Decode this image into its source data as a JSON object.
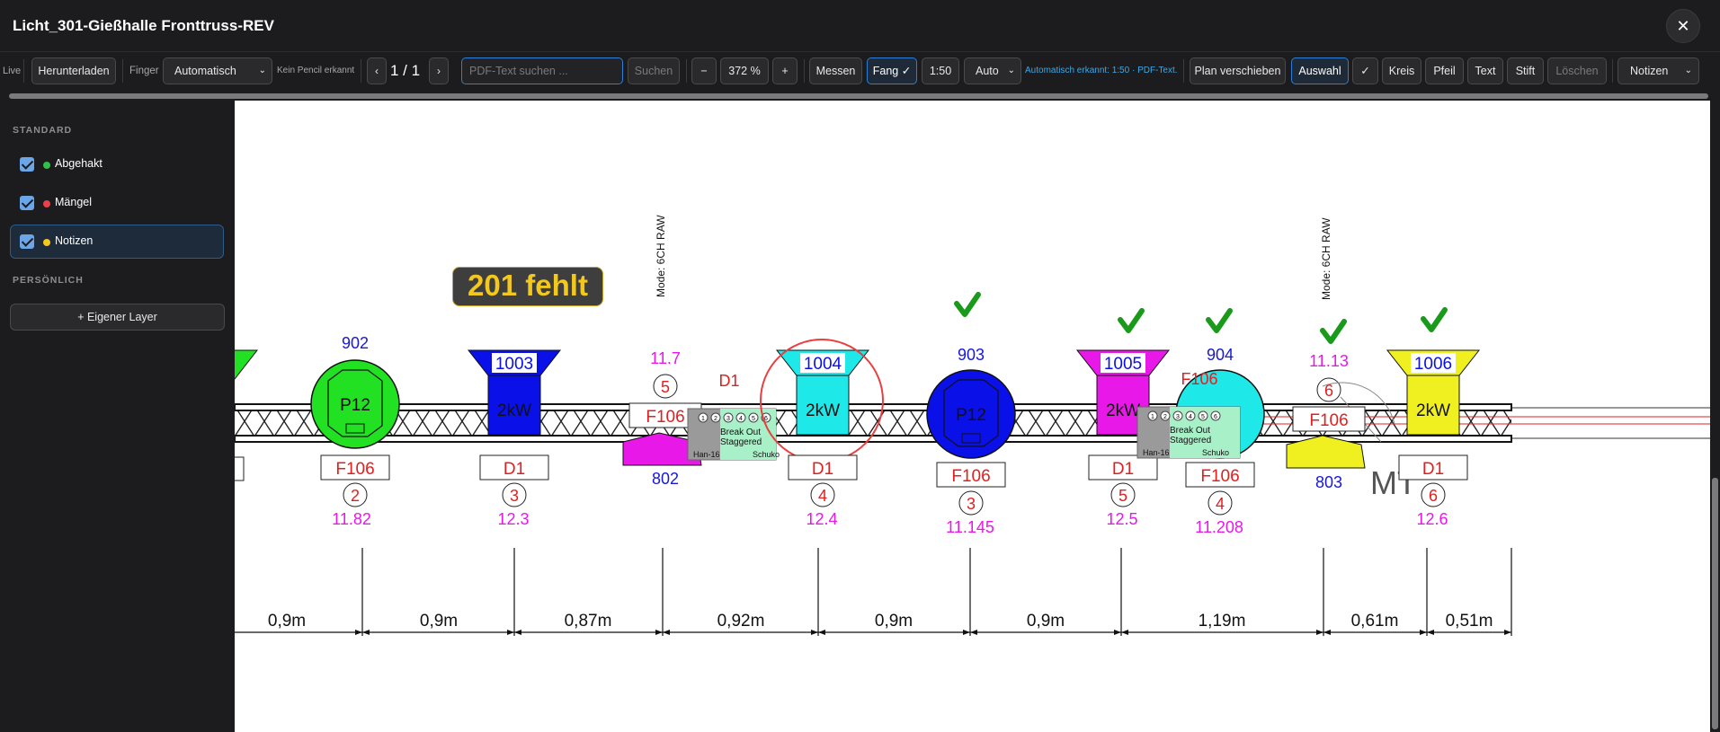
{
  "window": {
    "title": "Licht_301-Gießhalle Fronttruss-REV",
    "close_symbol": "✕"
  },
  "toolbar": {
    "live_label": "Live",
    "download_label": "Herunterladen",
    "finger_label": "Finger",
    "finger_select": "Automatisch",
    "pencil_status": "Kein Pencil erkannt",
    "page_prev": "‹",
    "page_indicator": "1 / 1",
    "page_next": "›",
    "search_placeholder": "PDF-Text suchen ...",
    "search_button": "Suchen",
    "zoom_out": "−",
    "zoom_level": "372 %",
    "zoom_in": "+",
    "measure_label": "Messen",
    "snap_label": "Fang ✓",
    "scale_label": "1:50",
    "scale_mode": "Auto",
    "scale_detected": "Automatisch erkannt: 1:50 · PDF-Text.",
    "move_plan_label": "Plan verschieben",
    "select_label": "Auswahl",
    "check_label": "✓",
    "circle_label": "Kreis",
    "arrow_label": "Pfeil",
    "text_label": "Text",
    "pen_label": "Stift",
    "delete_label": "Löschen",
    "layer_select": "Notizen"
  },
  "sidebar": {
    "standard_heading": "STANDARD",
    "layers": [
      {
        "label": "Abgehakt",
        "color": "#30c04a"
      },
      {
        "label": "Mängel",
        "color": "#e8414a"
      },
      {
        "label": "Notizen",
        "color": "#f3c81e"
      }
    ],
    "personal_heading": "PERSÖNLICH",
    "add_layer_label": "+ Eigener Layer"
  },
  "plan": {
    "note_badge": "201 fehlt",
    "mode_labels": [
      "Mode: 6CH RAW",
      "Mode: 6CH RAW"
    ],
    "fixtures": [
      {
        "id": "902",
        "type": "P12",
        "circuit": "F106",
        "channel": "2",
        "address": "11.82",
        "color": "#22e022"
      },
      {
        "id": "1003",
        "type": "2kW",
        "circuit": "D1",
        "channel": "3",
        "address": "12.3",
        "color": "#0a10e8"
      },
      {
        "id": "802",
        "circuit": "F106",
        "channel": "5",
        "address": "11.7",
        "color": "#e818e8"
      },
      {
        "id": "1004",
        "type": "2kW",
        "circuit": "D1",
        "channel": "4",
        "address": "12.4",
        "color": "#1ee8e8"
      },
      {
        "id": "903",
        "type": "P12",
        "circuit": "F106",
        "channel": "3",
        "address": "11.145",
        "color": "#0a10e8"
      },
      {
        "id": "1005",
        "type": "2kW",
        "circuit": "D1",
        "channel": "5",
        "address": "12.5",
        "color": "#e818e8"
      },
      {
        "id": "904",
        "circuit": "F106",
        "channel": "4",
        "address": "11.208",
        "color": "#1ee8e8"
      },
      {
        "id": "803",
        "circuit": "F106",
        "channel": "6",
        "address": "11.13",
        "color": "#f0f020"
      },
      {
        "id": "1006",
        "type": "2kW",
        "circuit": "D1",
        "channel": "6",
        "address": "12.6",
        "color": "#f0f020"
      }
    ],
    "extra_labels": {
      "d1_top": "D1",
      "f106_overlap": "F106",
      "mt": "MT"
    },
    "breakout": {
      "line1": "Break Out",
      "line2": "Staggered",
      "han": "Han-16",
      "schuko": "Schuko",
      "pins": [
        "1",
        "2",
        "3",
        "4",
        "5",
        "6"
      ]
    },
    "dimensions": [
      "0,9m",
      "0,9m",
      "0,87m",
      "0,92m",
      "0,9m",
      "0,9m",
      "1,19m",
      "0,61m",
      "0,51m"
    ]
  }
}
